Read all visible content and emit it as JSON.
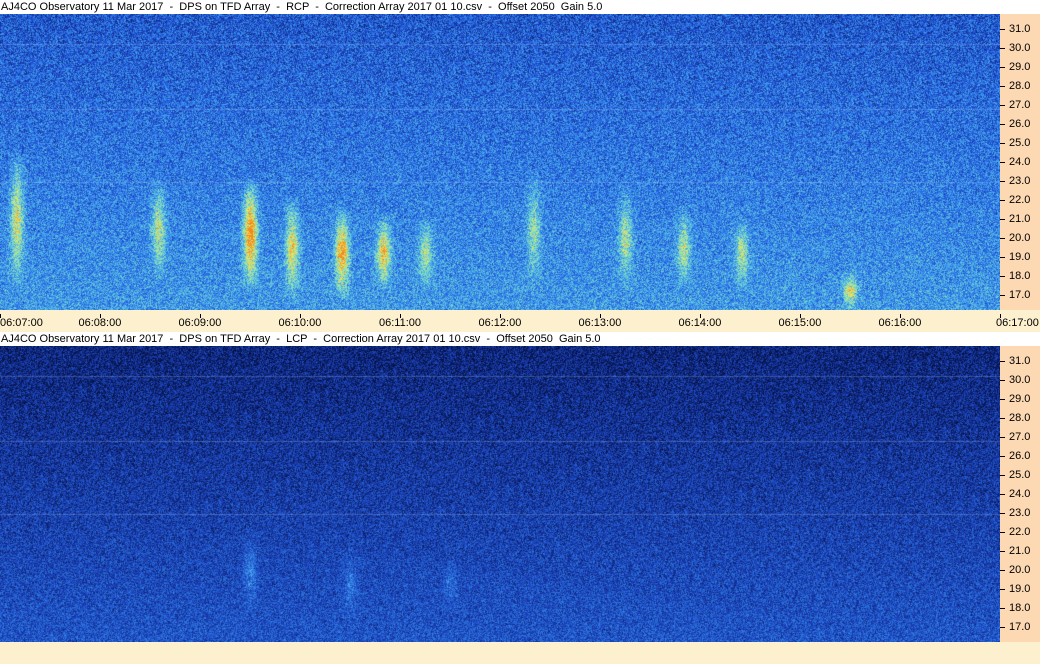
{
  "panels": [
    {
      "title": "AJ4CO Observatory 11 Mar 2017  -  DPS on TFD Array  -  RCP  -  Correction Array 2017 01 10.csv  -  Offset 2050  Gain 5.0",
      "polarization": "RCP",
      "y_ticks": [
        "31.0",
        "30.0",
        "29.0",
        "28.0",
        "27.0",
        "26.0",
        "25.0",
        "24.0",
        "23.0",
        "22.0",
        "21.0",
        "20.0",
        "19.0",
        "18.0",
        "17.0"
      ],
      "x_ticks": [
        "06:07:00",
        "06:08:00",
        "06:09:00",
        "06:10:00",
        "06:11:00",
        "06:12:00",
        "06:13:00",
        "06:14:00",
        "06:15:00",
        "06:16:00",
        "06:17:00"
      ]
    },
    {
      "title": "AJ4CO Observatory 11 Mar 2017  -  DPS on TFD Array  -  LCP  -  Correction Array 2017 01 10.csv  -  Offset 2050  Gain 5.0",
      "polarization": "LCP",
      "y_ticks": [
        "31.0",
        "30.0",
        "29.0",
        "28.0",
        "27.0",
        "26.0",
        "25.0",
        "24.0",
        "23.0",
        "22.0",
        "21.0",
        "20.0",
        "19.0",
        "18.0",
        "17.0"
      ]
    }
  ],
  "chart_data": [
    {
      "type": "heatmap",
      "title": "AJ4CO Observatory 11 Mar 2017  -  DPS on TFD Array  -  RCP  -  Correction Array 2017 01 10.csv  -  Offset 2050  Gain 5.0",
      "x_range": [
        "06:07:00",
        "06:17:00"
      ],
      "y_range": [
        16.2,
        31.8
      ],
      "colormap": [
        "#0a1a5c",
        "#1f4fd6",
        "#3d9bef",
        "#7ee0c8",
        "#f0e65a",
        "#f08a1e"
      ],
      "bursts": [
        {
          "time": "06:07:10",
          "freq_min": 17.5,
          "freq_max": 24.5,
          "intensity": 0.5
        },
        {
          "time": "06:08:35",
          "freq_min": 18.0,
          "freq_max": 23.0,
          "intensity": 0.45
        },
        {
          "time": "06:09:30",
          "freq_min": 17.5,
          "freq_max": 23.0,
          "intensity": 0.85
        },
        {
          "time": "06:09:55",
          "freq_min": 17.0,
          "freq_max": 22.0,
          "intensity": 0.55
        },
        {
          "time": "06:10:25",
          "freq_min": 17.0,
          "freq_max": 21.5,
          "intensity": 0.75
        },
        {
          "time": "06:10:50",
          "freq_min": 17.5,
          "freq_max": 21.0,
          "intensity": 0.65
        },
        {
          "time": "06:11:15",
          "freq_min": 17.5,
          "freq_max": 21.0,
          "intensity": 0.4
        },
        {
          "time": "06:12:20",
          "freq_min": 17.5,
          "freq_max": 23.5,
          "intensity": 0.35
        },
        {
          "time": "06:13:15",
          "freq_min": 17.5,
          "freq_max": 22.5,
          "intensity": 0.4
        },
        {
          "time": "06:13:50",
          "freq_min": 17.5,
          "freq_max": 21.5,
          "intensity": 0.4
        },
        {
          "time": "06:14:25",
          "freq_min": 17.5,
          "freq_max": 21.0,
          "intensity": 0.4
        },
        {
          "time": "06:15:30",
          "freq_min": 16.5,
          "freq_max": 18.0,
          "intensity": 0.5
        }
      ]
    },
    {
      "type": "heatmap",
      "title": "AJ4CO Observatory 11 Mar 2017  -  DPS on TFD Array  -  LCP  -  Correction Array 2017 01 10.csv  -  Offset 2050  Gain 5.0",
      "x_range": [
        "06:07:00",
        "06:17:00"
      ],
      "y_range": [
        16.2,
        31.8
      ],
      "colormap": [
        "#05103f",
        "#1a3fb8",
        "#2f7fe6",
        "#6fc7ec",
        "#d8e96a"
      ],
      "bursts": [
        {
          "time": "06:09:30",
          "freq_min": 18.0,
          "freq_max": 22.0,
          "intensity": 0.25
        },
        {
          "time": "06:10:30",
          "freq_min": 17.5,
          "freq_max": 21.0,
          "intensity": 0.2
        },
        {
          "time": "06:11:30",
          "freq_min": 18.0,
          "freq_max": 20.5,
          "intensity": 0.15
        }
      ]
    }
  ]
}
